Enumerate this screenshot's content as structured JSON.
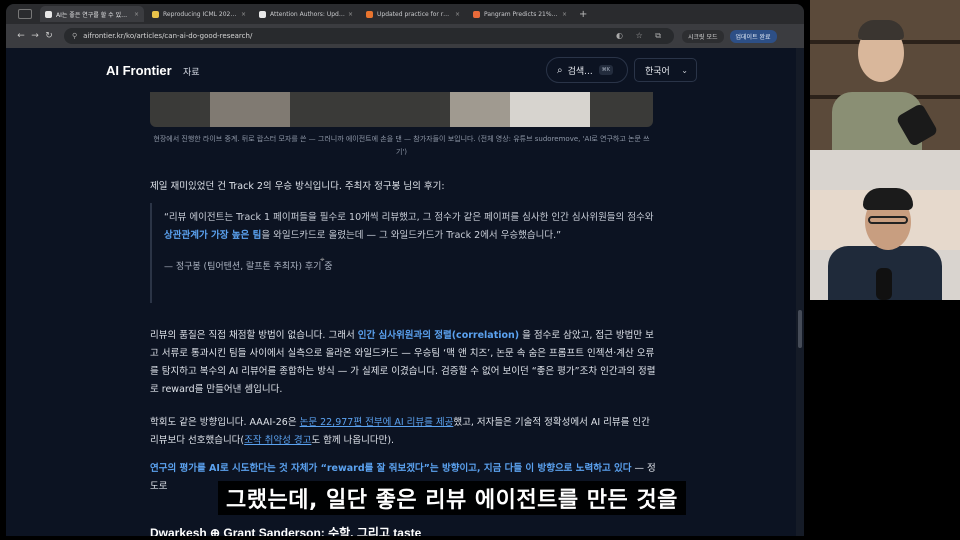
{
  "browser": {
    "tabs": [
      {
        "label": "AI는 좋은 연구를 할 수 있을까 — ",
        "active": true,
        "fav_color": "#e8e8e8"
      },
      {
        "label": "Reproducing ICML 2026 - a ",
        "active": false,
        "fav_color": "#e9c24a"
      },
      {
        "label": "Attention Authors: Updated ",
        "active": false,
        "fav_color": "#e8e8e8"
      },
      {
        "label": "Updated practice for review ",
        "active": false,
        "fav_color": "#e8742e"
      },
      {
        "label": "Pangram Predicts 21% of IC",
        "active": false,
        "fav_color": "#e86a3a"
      }
    ],
    "close_glyph": "×",
    "newtab_glyph": "+",
    "url": "aifrontier.kr/ko/articles/can-ai-do-good-research/",
    "nav": {
      "back": "←",
      "forward": "→",
      "reload": "↻"
    },
    "url_icons": "◐ ☆ ⧉",
    "right_chips": [
      "시크릿 모드",
      "업데이트 완료"
    ]
  },
  "site": {
    "brand": "AI Frontier",
    "nav_link": "자료",
    "search_label": "검색...",
    "search_kbd": "⌘K",
    "search_icon": "magnifier-icon",
    "language": "한국어",
    "chevron": "⌄"
  },
  "article": {
    "caption": "현장에서 진행한 라이브 중계. 뒤로 랍스터 모자를 쓴 — 그러니까 에이전트에 손을 댄 — 참가자들이 보입니다. (전체 영상: 유튜브 sudoremove, 'AI로 연구하고 논문 쓰기')",
    "para1": "제일 재미있었던 건 Track 2의 우승 방식입니다. 주최자 정구봉 님의 후기:",
    "quote": {
      "pre": "“리뷰 에이전트는 Track 1 페이퍼들을 필수로 10개씩 리뷰했고, 그 점수가 같은 페이퍼를 심사한 인간 심사위원들의 점수와 ",
      "hl": "상관관계가 가장 높은 팀",
      "post": "을 와일드카드로 올렸는데 — 그 와일드카드가 Track 2에서 우승했습니다.”",
      "attr": "— 정구봉 (팀어텐션, 랄프톤 주최자) 후기 중"
    },
    "para2": {
      "pre": "리뷰의 품질은 직접 채점할 방법이 없습니다. 그래서 ",
      "hl": "인간 심사위원과의 정렬(correlation)",
      "post": " 을 점수로 삼았고, 접근 방법만 보고 서류로 통과시킨 팀들 사이에서 실측으로 올라온 와일드카드 — 우승팀 ‘맥 앤 치즈’, 논문 속 숨은 프롬프트 인젝션·계산 오류를 탐지하고 복수의 AI 리뷰어를 종합하는 방식 — 가 실제로 이겼습니다. 검증할 수 없어 보이던 “좋은 평가”조차 인간과의 정렬로 reward를 만들어낸 셈입니다."
    },
    "para3": {
      "pre": "학회도 같은 방향입니다. AAAI-26은 ",
      "link1": "논문 22,977편 전부에 AI 리뷰를 제공",
      "mid": "했고, 저자들은 기술적 정확성에서 AI 리뷰를 인간 리뷰보다 선호했습니다(",
      "link2": "조작 취약성 경고",
      "post": "도 함께 나옵니다만)."
    },
    "para4": {
      "hl": "연구의 평가를 AI로 시도한다는 것 자체가 “reward를 잘 줘보겠다”는 방향이고, 지금 다들 이 방향으로 노력하고 있다",
      "post": " — 정도로"
    },
    "heading": "Dwarkesh ⊕ Grant Sanderson: 수학, 그리고 taste"
  },
  "subtitle": "그랬는데, 일단 좋은 리뷰 에이전트를 만든 것을"
}
